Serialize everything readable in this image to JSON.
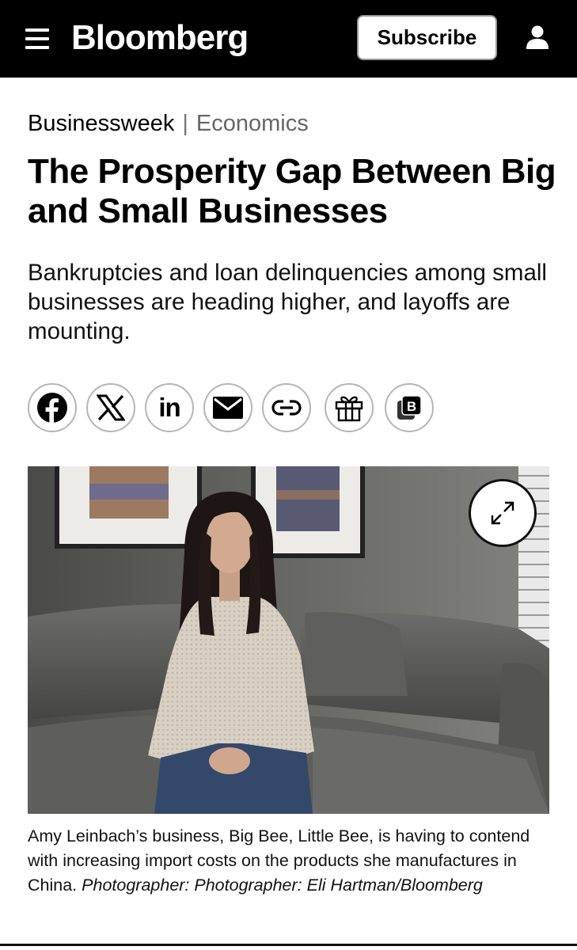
{
  "header": {
    "logo": "Bloomberg",
    "subscribe_label": "Subscribe",
    "menu_icon": "hamburger-menu-icon",
    "account_icon": "user-icon"
  },
  "article": {
    "section": "Businessweek",
    "separator": "|",
    "subsection": "Economics",
    "headline": "The Prosperity Gap Between Big and Small Businesses",
    "dek": "Bankruptcies and loan delinquencies among small businesses are heading higher, and layoffs are mounting."
  },
  "share_buttons": [
    {
      "name": "facebook",
      "icon": "facebook-icon"
    },
    {
      "name": "x",
      "icon": "x-icon"
    },
    {
      "name": "linkedin",
      "icon": "linkedin-icon",
      "glyph": "in"
    },
    {
      "name": "email",
      "icon": "mail-icon"
    },
    {
      "name": "copy-link",
      "icon": "link-icon"
    },
    {
      "name": "gift",
      "icon": "gift-icon"
    },
    {
      "name": "bookmark",
      "icon": "bloomberg-save-icon",
      "glyph": "B"
    }
  ],
  "photo": {
    "expand_icon": "expand-icon"
  },
  "caption": {
    "text": "Amy Leinbach’s business, Big Bee, Little Bee, is having to contend with increasing import costs on the products she manufactures in China.",
    "credit": "Photographer: Photographer: Eli Hartman/Bloomberg"
  },
  "colors": {
    "header_bg": "#000000",
    "text": "#000000",
    "muted": "#666666",
    "share_border": "#b5b5b5"
  }
}
